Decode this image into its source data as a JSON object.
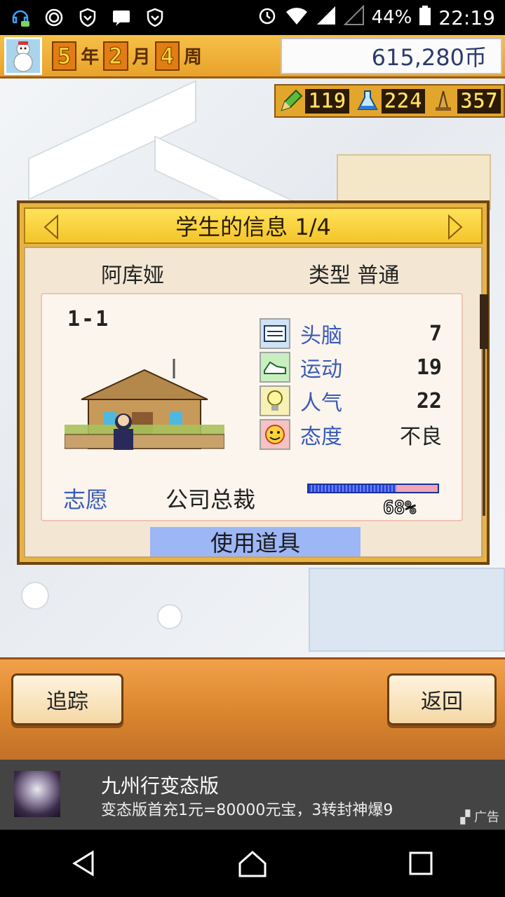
{
  "status_bar": {
    "icons": [
      "headset-chat-icon",
      "swirl-icon",
      "shield-icon",
      "message-icon",
      "shield-icon"
    ],
    "battery": "44%",
    "time": "22:19"
  },
  "game": {
    "date": {
      "year_num": "5",
      "year_unit": "年",
      "month_num": "2",
      "month_unit": "月",
      "week_num": "4",
      "week_unit": "周"
    },
    "money": "615,280币",
    "resources": [
      {
        "icon": "pencil-icon",
        "value": "119"
      },
      {
        "icon": "flask-icon",
        "value": "224"
      },
      {
        "icon": "hat-icon",
        "value": "357"
      }
    ]
  },
  "dialog": {
    "title": "学生的信息 1/4",
    "student_name": "阿库娅",
    "student_type": "类型 普通",
    "grade": "1-1",
    "stats": [
      {
        "icon": "brain-icon",
        "label": "头脑",
        "value": "7"
      },
      {
        "icon": "sneaker-icon",
        "label": "运动",
        "value": "19"
      },
      {
        "icon": "lightbulb-icon",
        "label": "人气",
        "value": "22"
      },
      {
        "icon": "face-icon",
        "label": "态度",
        "value": "不良"
      }
    ],
    "aspiration_label": "志愿",
    "aspiration_value": "公司总裁",
    "progress_pct": 68,
    "progress_label": "68%",
    "use_item": "使用道具"
  },
  "bottom": {
    "track": "追踪",
    "back": "返回"
  },
  "ad": {
    "title": "九州行变态版",
    "subtitle": "变态版首充1元=80000元宝，3转封神爆9",
    "tag": "广告"
  },
  "navbar": [
    "back-icon",
    "home-icon",
    "recents-icon"
  ]
}
